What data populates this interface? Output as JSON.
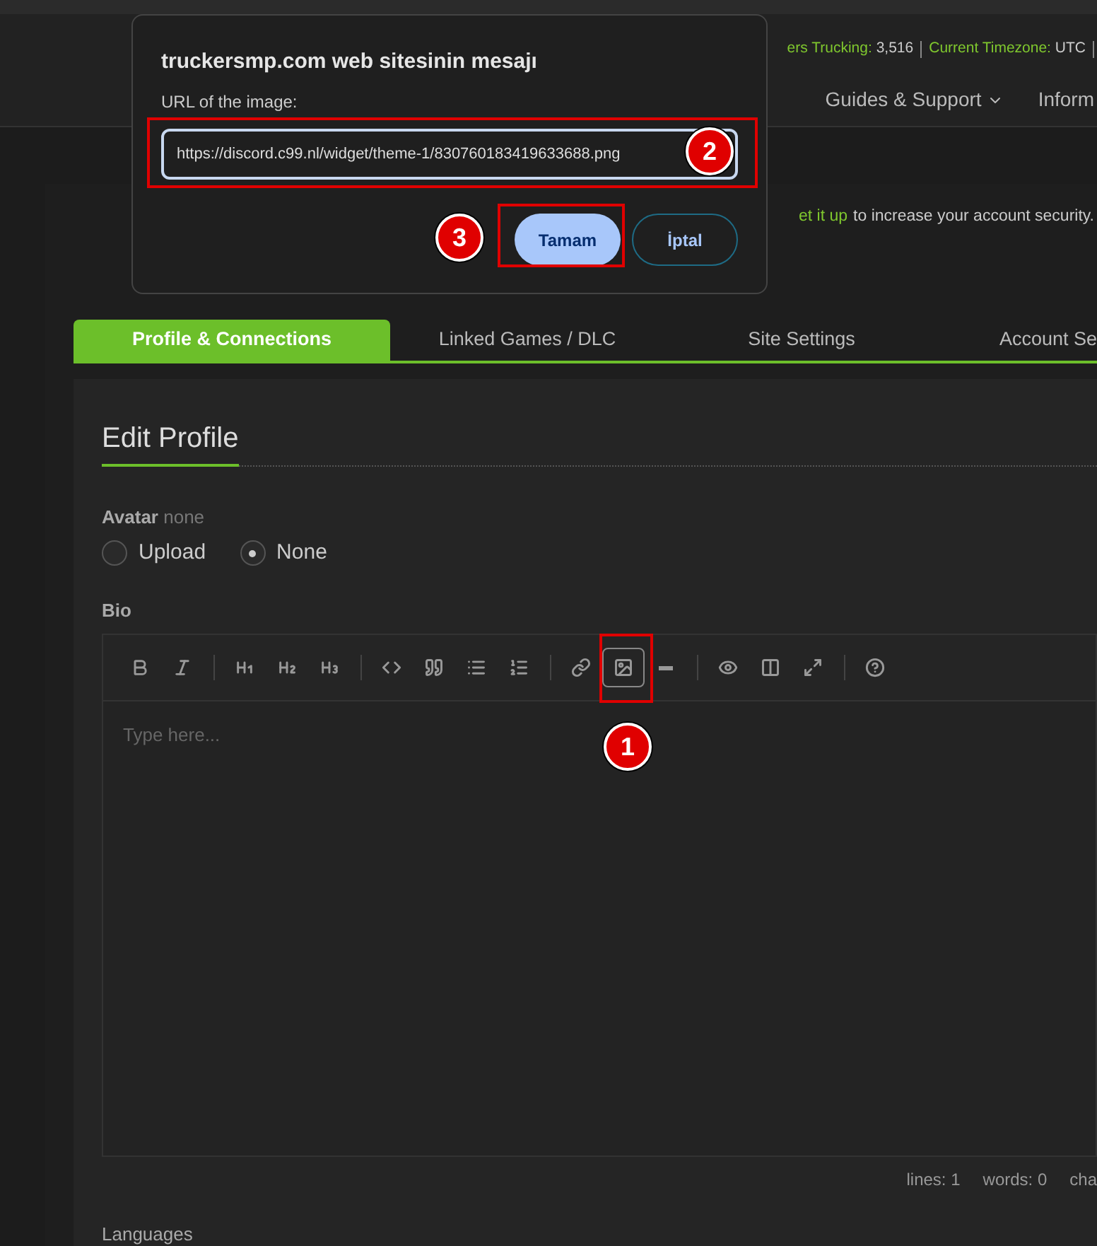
{
  "header": {
    "info": [
      {
        "label": "ers Trucking:",
        "value": "3,516"
      },
      {
        "label": "Current Timezone:",
        "value": "UTC"
      }
    ],
    "nav": [
      {
        "label": "Guides & Support",
        "dropdown": true
      },
      {
        "label": "Inform",
        "dropdown": false
      }
    ]
  },
  "notice": {
    "link": "et it up",
    "text": "to increase your account security."
  },
  "tabs": [
    {
      "label": "Profile & Connections",
      "selected": true
    },
    {
      "label": "Linked Games / DLC",
      "selected": false
    },
    {
      "label": "Site Settings",
      "selected": false
    },
    {
      "label": "Account Se",
      "selected": false
    }
  ],
  "section_title": "Edit Profile",
  "avatar": {
    "label": "Avatar",
    "hint": "none",
    "options": [
      {
        "label": "Upload",
        "selected": false
      },
      {
        "label": "None",
        "selected": true
      }
    ]
  },
  "bio": {
    "label": "Bio",
    "toolbar": [
      [
        {
          "active": false
        },
        {
          "active": false
        }
      ],
      [
        {
          "active": false
        },
        {
          "active": false
        },
        {
          "active": false
        }
      ],
      [
        {
          "active": false
        },
        {
          "active": false
        },
        {
          "active": false
        },
        {
          "active": false
        }
      ],
      [
        {
          "active": false
        },
        {
          "active": true
        },
        {
          "active": false
        }
      ],
      [
        {
          "active": false
        },
        {
          "active": false
        },
        {
          "active": false
        }
      ],
      [
        {
          "active": false
        }
      ]
    ],
    "placeholder": "Type here...",
    "status": [
      "lines: 1",
      "words: 0",
      "cha"
    ]
  },
  "languages_label": "Languages",
  "dialog": {
    "title": "truckersmp.com web sitesinin mesajı",
    "prompt": "URL of the image:",
    "value": "https://discord.c99.nl/widget/theme-1/830760183419633688.png",
    "buttons": [
      {
        "label": "Tamam",
        "primary": true
      },
      {
        "label": "İptal",
        "primary": false
      }
    ]
  },
  "annotations": [
    "1",
    "2",
    "3"
  ]
}
